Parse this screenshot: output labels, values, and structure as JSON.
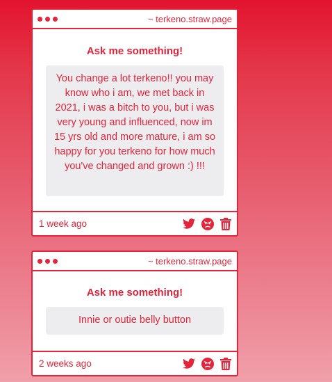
{
  "cards": [
    {
      "domain": "~ terkeno.straw.page",
      "heading": "Ask me something!",
      "question": "You change a lot terkeno!! you may know who i am, we met back in 2021, i was a bitch to you, but i was very young and influenced, now im 15 yrs old and more mature, i am so happy for you terkeno for how much you've changed and grown :) !!!",
      "time": "1 week ago"
    },
    {
      "domain": "~ terkeno.straw.page",
      "heading": "Ask me something!",
      "question": "Innie or outie belly button",
      "time": "2 weeks ago"
    }
  ],
  "icons": {
    "share": "twitter-icon",
    "react": "angry-face-icon",
    "delete": "trash-icon"
  },
  "colors": {
    "accent": "#e3243a",
    "box": "#edecee",
    "card": "#ffffff"
  }
}
